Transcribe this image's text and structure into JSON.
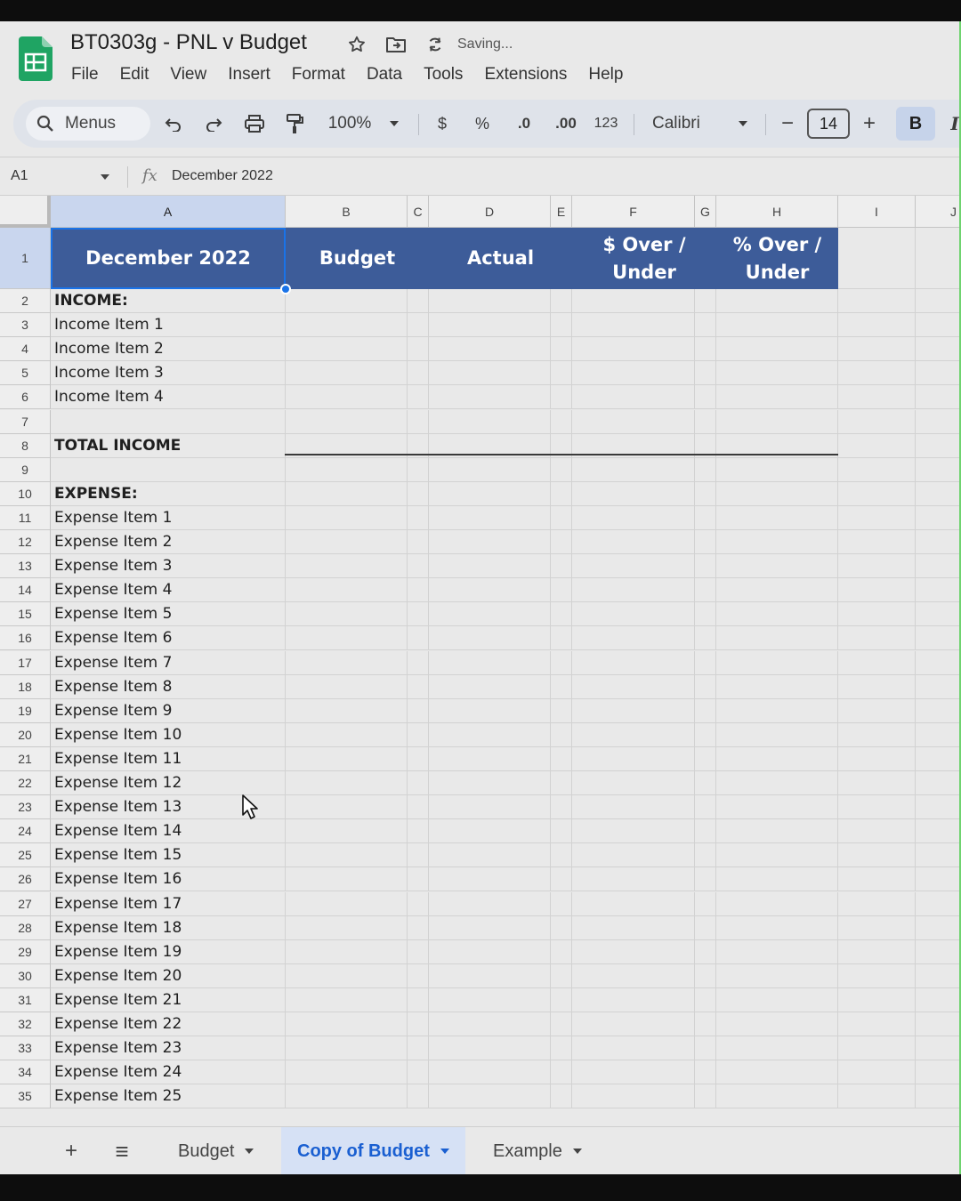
{
  "app": {
    "doc_title": "BT0303g - PNL v Budget",
    "status": "Saving..."
  },
  "menu": [
    "File",
    "Edit",
    "View",
    "Insert",
    "Format",
    "Data",
    "Tools",
    "Extensions",
    "Help"
  ],
  "toolbar": {
    "search_label": "Menus",
    "zoom": "100%",
    "currency": "$",
    "percent": "%",
    "decrease_decimal": ".0",
    "increase_decimal": ".00",
    "number_format": "123",
    "font": "Calibri",
    "font_size": "14",
    "minus": "−",
    "plus": "+",
    "bold": "B",
    "italic": "I"
  },
  "formula_bar": {
    "cell_ref": "A1",
    "fx": "fx",
    "content": "December 2022"
  },
  "columns": [
    "A",
    "B",
    "C",
    "D",
    "E",
    "F",
    "G",
    "H",
    "I",
    "J"
  ],
  "header_row": {
    "a": "December 2022",
    "b": "Budget",
    "d": "Actual",
    "f_line1": "$ Over /",
    "f_line2": "Under",
    "h_line1": "% Over /",
    "h_line2": "Under"
  },
  "rows": [
    {
      "n": "1"
    },
    {
      "n": "2",
      "a": "INCOME:",
      "bold": true
    },
    {
      "n": "3",
      "a": "Income Item 1"
    },
    {
      "n": "4",
      "a": "Income Item 2"
    },
    {
      "n": "5",
      "a": "Income Item 3"
    },
    {
      "n": "6",
      "a": "Income Item 4"
    },
    {
      "n": "7",
      "a": ""
    },
    {
      "n": "8",
      "a": "TOTAL INCOME",
      "bold": true
    },
    {
      "n": "9",
      "a": ""
    },
    {
      "n": "10",
      "a": "EXPENSE:",
      "bold": true
    },
    {
      "n": "11",
      "a": "Expense Item 1"
    },
    {
      "n": "12",
      "a": "Expense Item 2"
    },
    {
      "n": "13",
      "a": "Expense Item 3"
    },
    {
      "n": "14",
      "a": "Expense Item 4"
    },
    {
      "n": "15",
      "a": "Expense Item 5"
    },
    {
      "n": "16",
      "a": "Expense Item 6"
    },
    {
      "n": "17",
      "a": "Expense Item 7"
    },
    {
      "n": "18",
      "a": "Expense Item 8"
    },
    {
      "n": "19",
      "a": "Expense Item 9"
    },
    {
      "n": "20",
      "a": "Expense Item 10"
    },
    {
      "n": "21",
      "a": "Expense Item 11"
    },
    {
      "n": "22",
      "a": "Expense Item 12"
    },
    {
      "n": "23",
      "a": "Expense Item 13"
    },
    {
      "n": "24",
      "a": "Expense Item 14"
    },
    {
      "n": "25",
      "a": "Expense Item 15"
    },
    {
      "n": "26",
      "a": "Expense Item 16"
    },
    {
      "n": "27",
      "a": "Expense Item 17"
    },
    {
      "n": "28",
      "a": "Expense Item 18"
    },
    {
      "n": "29",
      "a": "Expense Item 19"
    },
    {
      "n": "30",
      "a": "Expense Item 20"
    },
    {
      "n": "31",
      "a": "Expense Item 21"
    },
    {
      "n": "32",
      "a": "Expense Item 22"
    },
    {
      "n": "33",
      "a": "Expense Item 23"
    },
    {
      "n": "34",
      "a": "Expense Item 24"
    },
    {
      "n": "35",
      "a": "Expense Item 25"
    }
  ],
  "sheets": {
    "add": "+",
    "list": "≡",
    "tabs": [
      "Budget",
      "Copy of Budget",
      "Example"
    ],
    "active": "Copy of Budget"
  },
  "colors": {
    "header_fill": "#3d5c99",
    "header_text": "#ffffff",
    "selection": "#1a73e8",
    "active_tab_text": "#1a5fd1"
  }
}
